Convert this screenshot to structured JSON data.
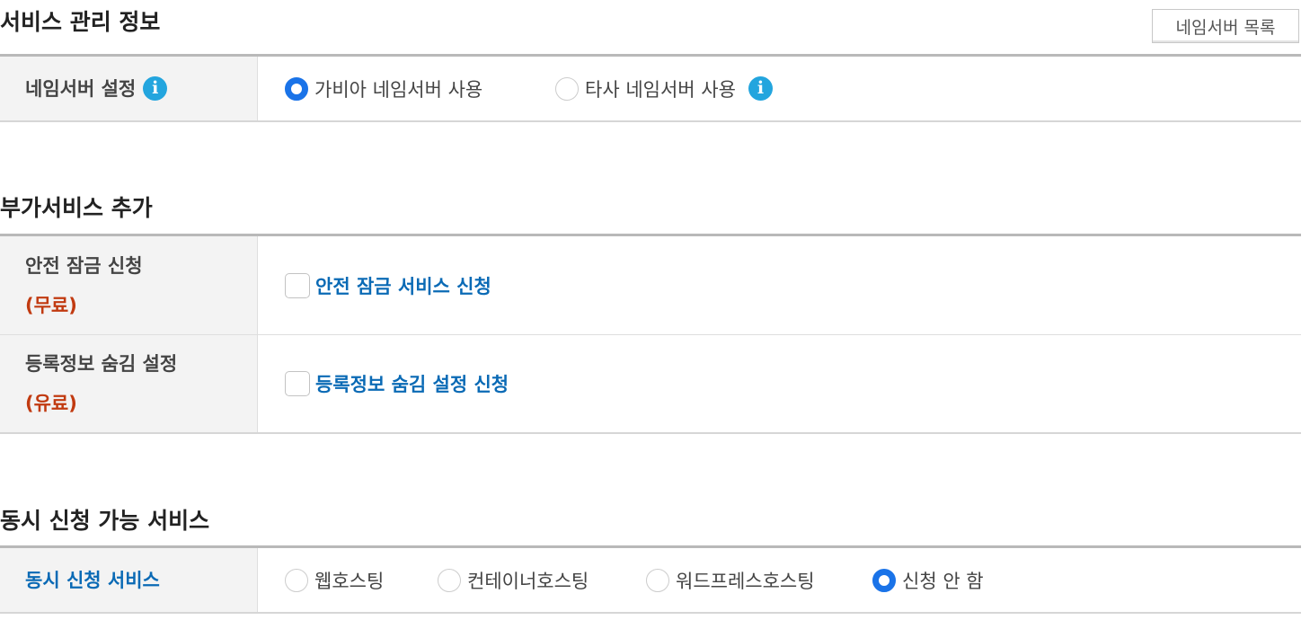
{
  "sections": {
    "service_info": {
      "title": "서비스 관리 정보",
      "nameserver_list_button": "네임서버 목록",
      "nameserver_setting": {
        "label": "네임서버 설정",
        "options": [
          "가비아 네임서버 사용",
          "타사 네임서버 사용"
        ],
        "selected": "가비아 네임서버 사용"
      }
    },
    "addon": {
      "title": "부가서비스 추가",
      "rows": [
        {
          "label": "안전 잠금 신청",
          "price": "(무료)",
          "checkbox_label": "안전 잠금 서비스 신청",
          "checked": false
        },
        {
          "label": "등록정보 숨김 설정",
          "price": "(유료)",
          "checkbox_label": "등록정보 숨김 설정 신청",
          "checked": false
        }
      ]
    },
    "concurrent": {
      "title": "동시 신청 가능 서비스",
      "label": "동시 신청 서비스",
      "options": [
        "웹호스팅",
        "컨테이너호스팅",
        "워드프레스호스팅",
        "신청 안 함"
      ],
      "selected": "신청 안 함"
    }
  },
  "icons": {
    "info": "info-icon"
  },
  "colors": {
    "accent_blue": "#1a73e8",
    "link_blue": "#0a6ab5",
    "price_red": "#c13a10",
    "info_icon": "#23a5de"
  }
}
